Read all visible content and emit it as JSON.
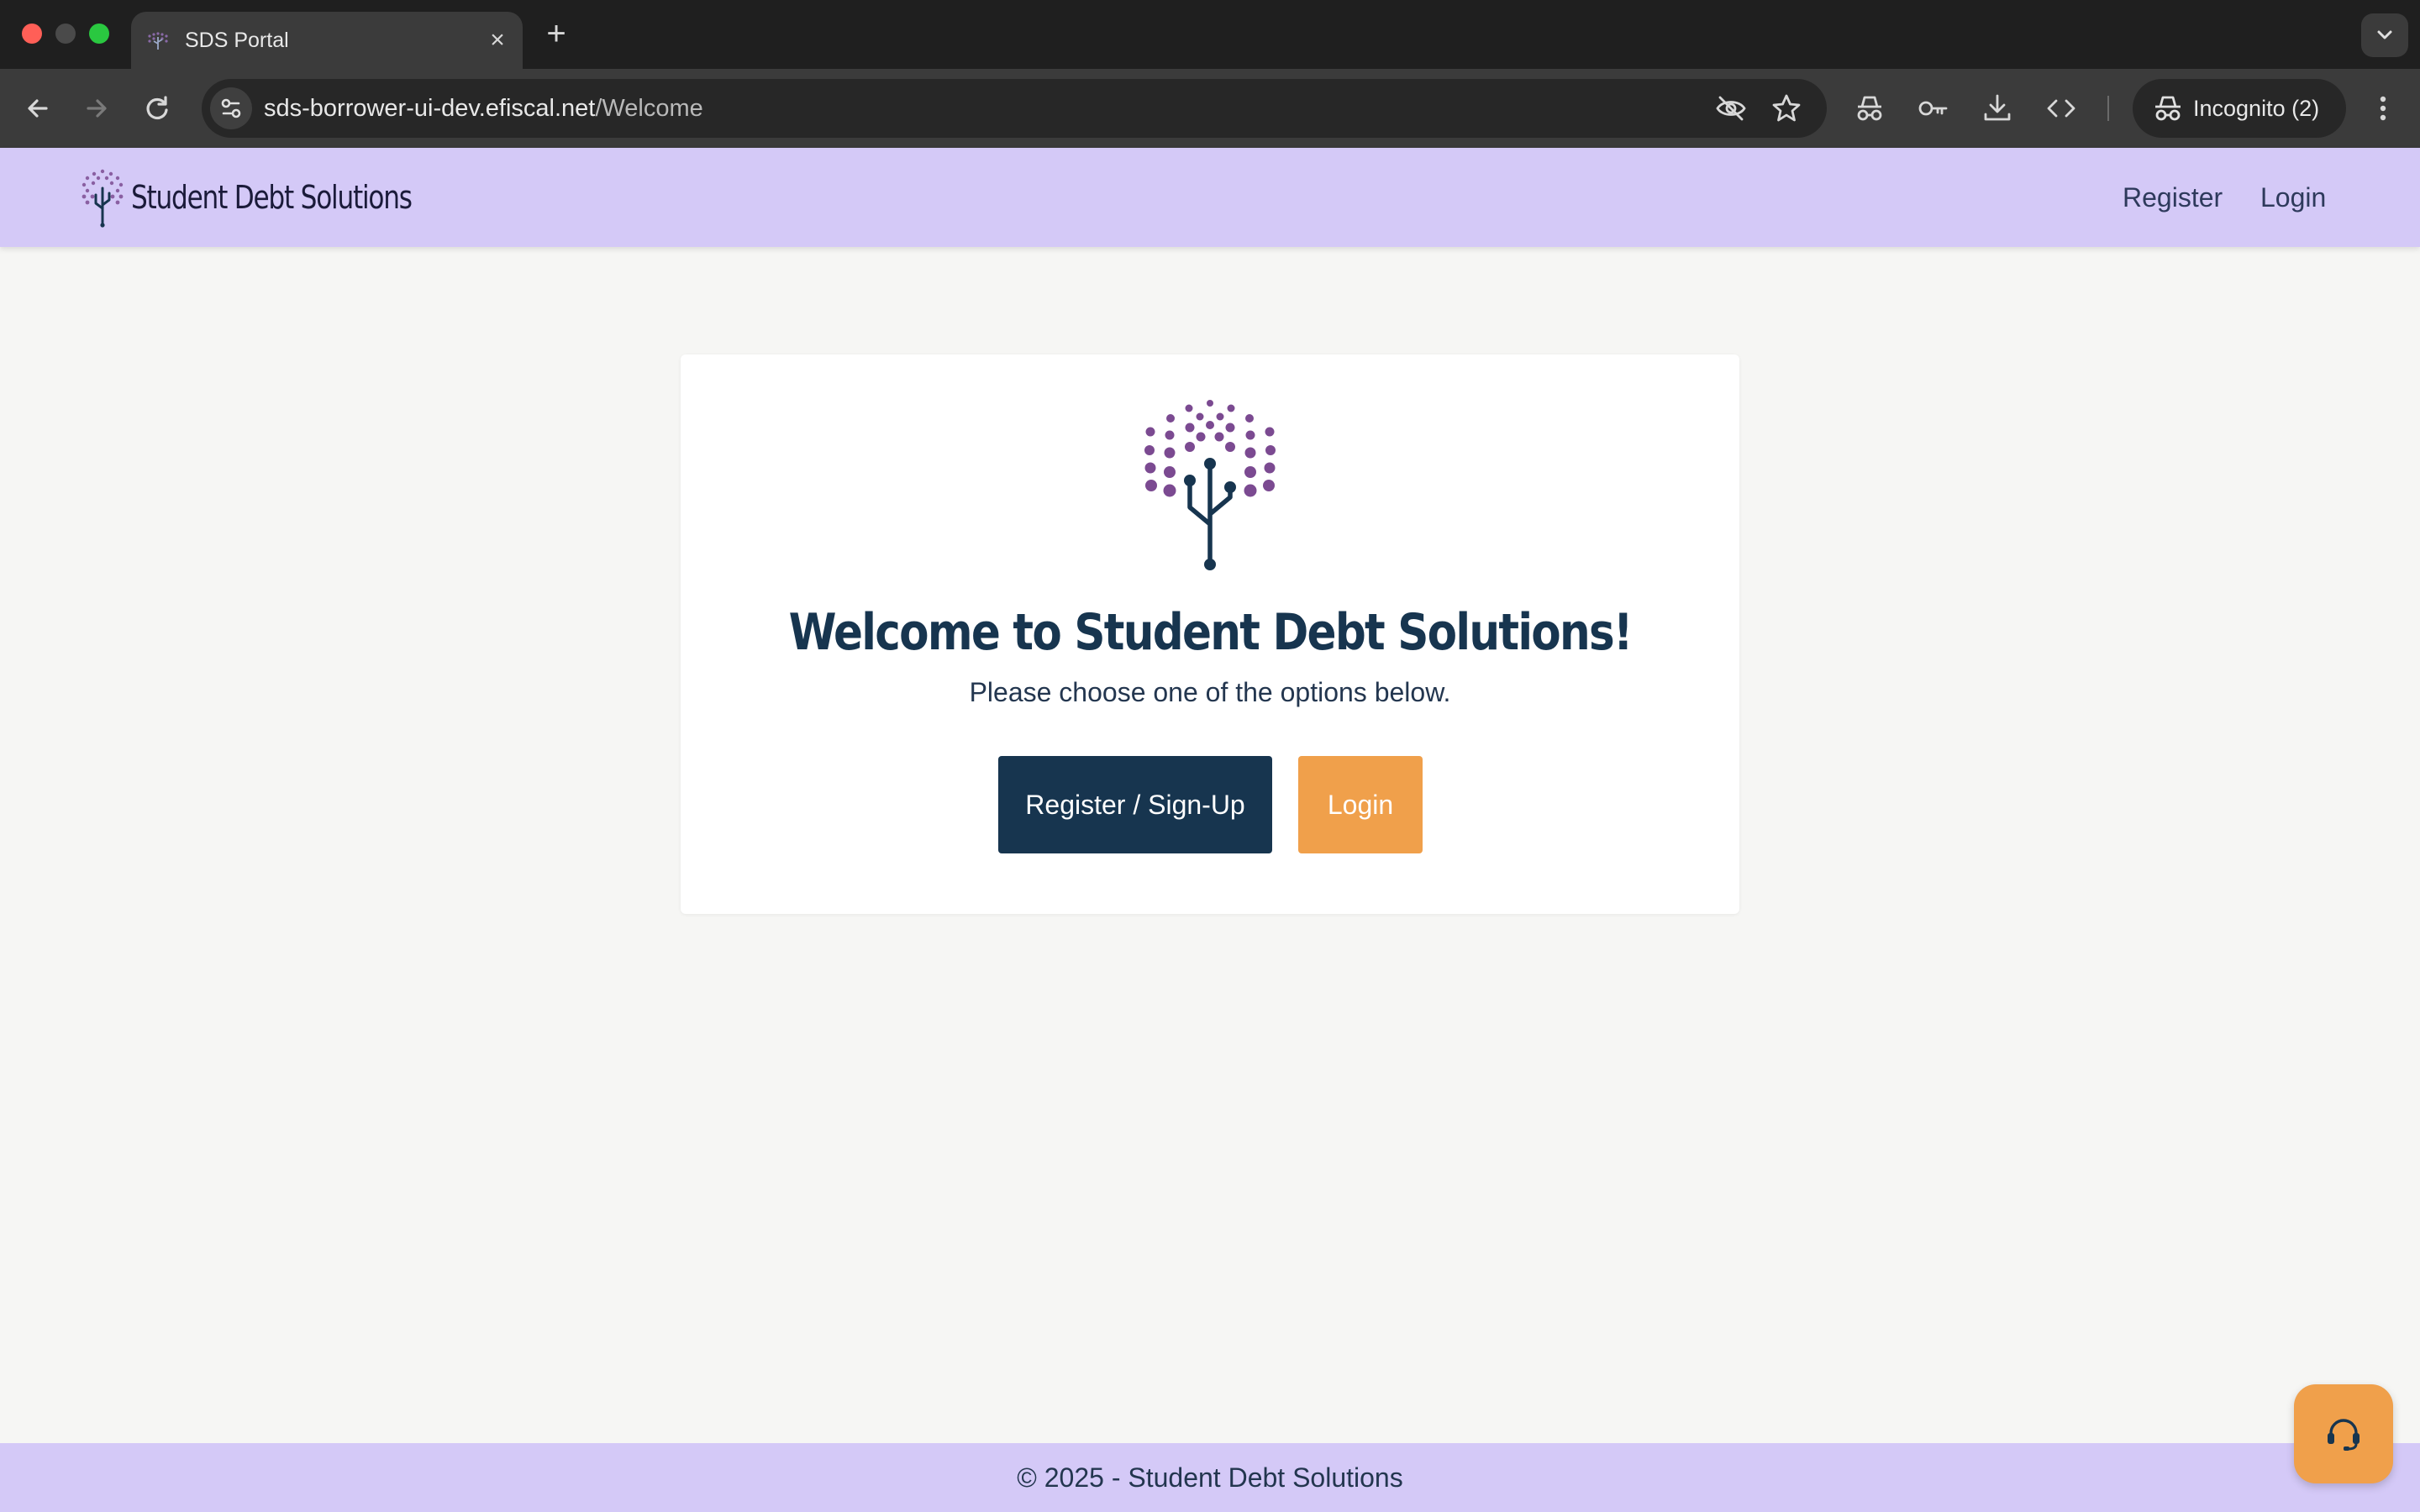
{
  "browser": {
    "tab_title": "SDS Portal",
    "url_host": "sds-borrower-ui-dev.efiscal.net",
    "url_path": "/Welcome",
    "profile_label": "Incognito (2)",
    "icons": [
      "back-arrow-icon",
      "forward-arrow-icon",
      "reload-icon",
      "site-info-icon",
      "eye-off-icon",
      "star-icon",
      "incognito-icon",
      "password-key-icon",
      "download-icon",
      "code-icon",
      "kebab-menu-icon",
      "chevron-down-icon",
      "plus-icon",
      "close-icon"
    ]
  },
  "header": {
    "brand_name": "Student Debt Solutions",
    "nav": {
      "register_label": "Register",
      "login_label": "Login"
    }
  },
  "welcome": {
    "title": "Welcome to Student Debt Solutions!",
    "subtitle": "Please choose one of the options below.",
    "register_button_label": "Register / Sign-Up",
    "login_button_label": "Login"
  },
  "footer": {
    "copyright": "© 2025 - Student Debt Solutions"
  },
  "support": {
    "icon": "headset-icon"
  },
  "colors": {
    "header_bg": "#d4c9f7",
    "primary_navy": "#17354f",
    "accent_orange": "#f0a04b",
    "logo_purple": "#7b4a91",
    "page_bg": "#f6f6f4"
  }
}
